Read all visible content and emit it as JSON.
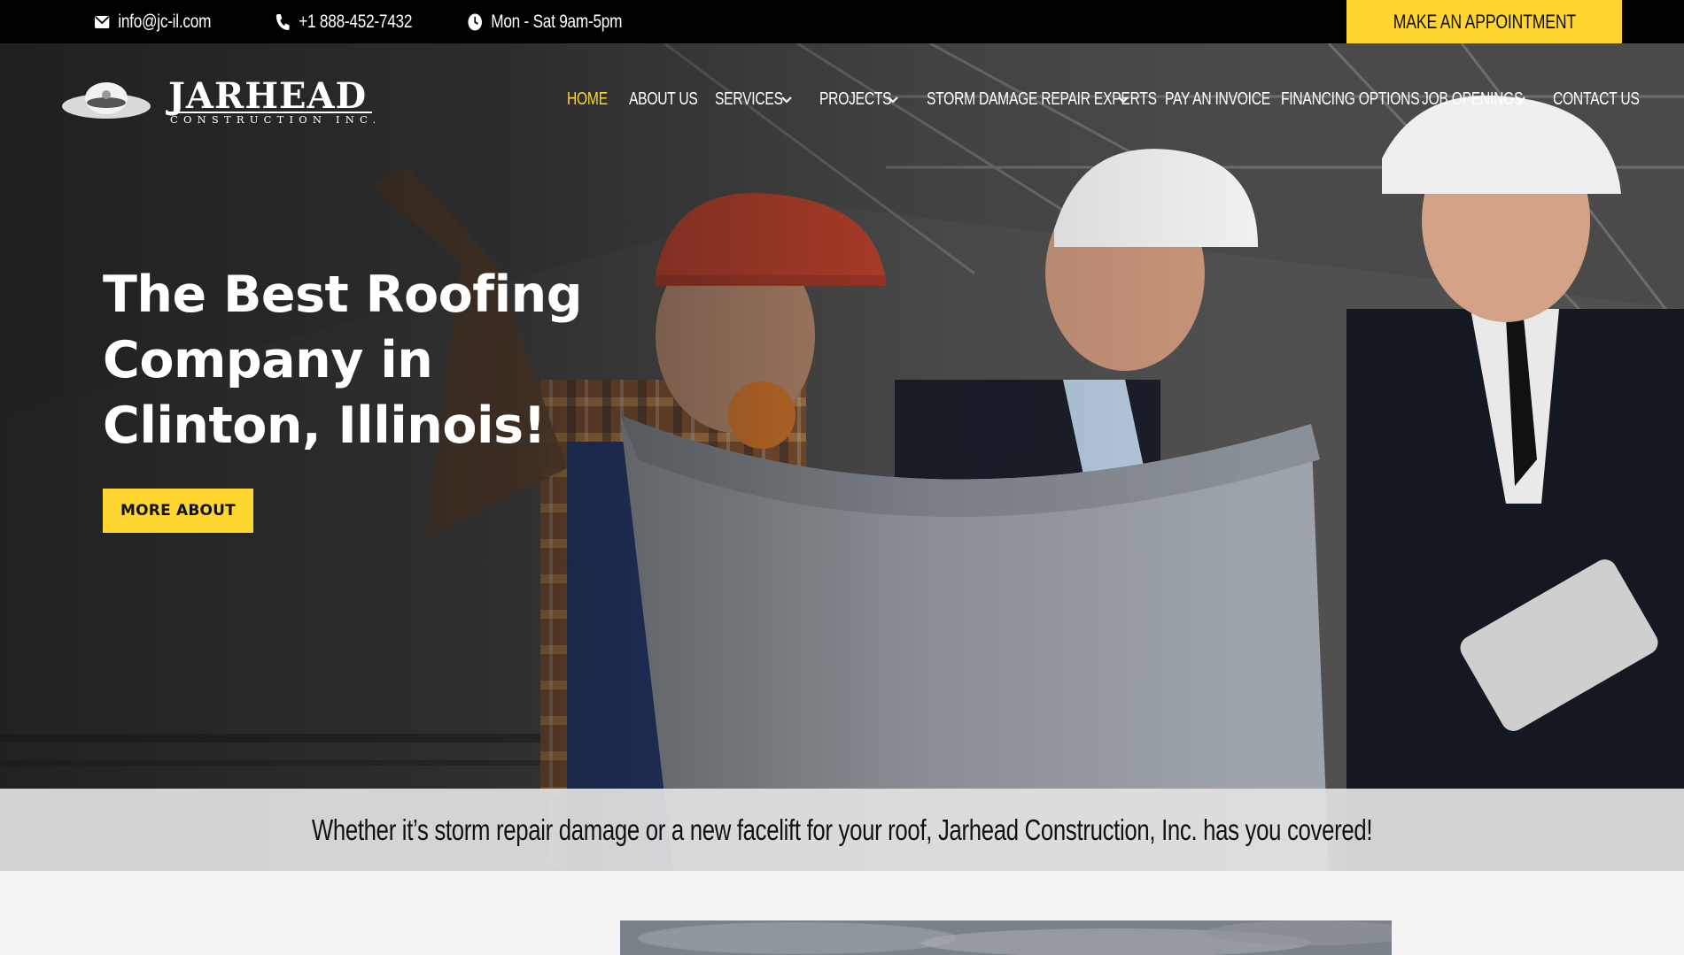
{
  "topbar": {
    "email": "info@jc-il.com",
    "phone": "+1 888-452-7432",
    "hours": "Mon - Sat 9am-5pm",
    "appointment_label": "MAKE AN APPOINTMENT",
    "icons": {
      "email": "envelope-icon",
      "phone": "phone-icon",
      "hours": "clock-icon"
    }
  },
  "brand": {
    "logo_word": "JARHEAD",
    "logo_sub": "CONSTRUCTION INC."
  },
  "nav": {
    "items": [
      {
        "label": "HOME",
        "active": true,
        "dropdown": false
      },
      {
        "label": "ABOUT US",
        "active": false,
        "dropdown": false
      },
      {
        "label": "SERVICES",
        "active": false,
        "dropdown": true
      },
      {
        "label": "PROJECTS",
        "active": false,
        "dropdown": true
      },
      {
        "label": "STORM DAMAGE REPAIR EXPERTS",
        "active": false,
        "dropdown": true
      },
      {
        "label": "PAY AN INVOICE",
        "active": false,
        "dropdown": false
      },
      {
        "label": "FINANCING OPTIONS",
        "active": false,
        "dropdown": false
      },
      {
        "label": "JOB OPENINGS",
        "active": false,
        "dropdown": true
      },
      {
        "label": "CONTACT US",
        "active": false,
        "dropdown": false
      }
    ]
  },
  "hero": {
    "headline_line1": "The Best Roofing",
    "headline_line2": "Company in",
    "headline_line3": "Clinton, Illinois!",
    "button_label": "MORE ABOUT"
  },
  "strip": {
    "text": "Whether it’s storm repair damage or a new facelift for your roof, Jarhead Construction, Inc. has you covered!"
  },
  "colors": {
    "accent": "#fed62f",
    "topbar_bg": "#000000",
    "page_bg": "#f3f3f3"
  }
}
